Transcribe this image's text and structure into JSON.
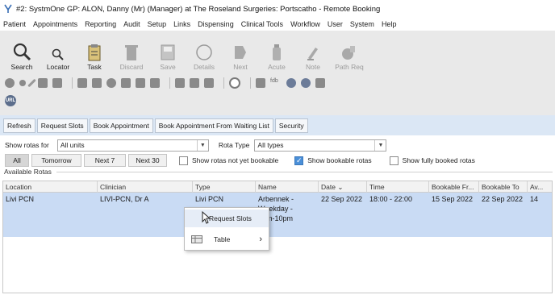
{
  "window": {
    "title": "#2: SystmOne GP: ALON, Danny (Mr) (Manager) at The Roseland Surgeries: Portscatho - Remote Booking"
  },
  "menu": [
    "Patient",
    "Appointments",
    "Reporting",
    "Audit",
    "Setup",
    "Links",
    "Dispensing",
    "Clinical Tools",
    "Workflow",
    "User",
    "System",
    "Help"
  ],
  "toolbar": {
    "items": [
      {
        "label": "Search",
        "icon": "magnifier-large-icon",
        "enabled": true
      },
      {
        "label": "Locator",
        "icon": "magnifier-small-icon",
        "enabled": true
      },
      {
        "label": "Task",
        "icon": "task-clipboard-icon",
        "enabled": true
      },
      {
        "label": "Discard",
        "icon": "trash-bin-icon",
        "enabled": false
      },
      {
        "label": "Save",
        "icon": "save-icon",
        "enabled": false
      },
      {
        "label": "Details",
        "icon": "details-circle-icon",
        "enabled": false
      },
      {
        "label": "Next",
        "icon": "next-arrow-icon",
        "enabled": false
      },
      {
        "label": "Acute",
        "icon": "acute-bottle-icon",
        "enabled": false
      },
      {
        "label": "Note",
        "icon": "note-icon",
        "enabled": false
      },
      {
        "label": "Path Req",
        "icon": "pathology-request-icon",
        "enabled": false
      }
    ],
    "url_icon": "URL"
  },
  "actions": [
    "Refresh",
    "Request Slots",
    "Book Appointment",
    "Book Appointment From Waiting List",
    "Security"
  ],
  "filters": {
    "show_label": "Show rotas for",
    "show_value": "All units",
    "type_label": "Rota Type",
    "type_value": "All types"
  },
  "segments": [
    "All",
    "Tomorrow",
    "Next 7",
    "Next 30"
  ],
  "checks": [
    {
      "label": "Show rotas not yet bookable",
      "checked": false
    },
    {
      "label": "Show bookable rotas",
      "checked": true
    },
    {
      "label": "Show fully booked rotas",
      "checked": false
    }
  ],
  "group_label": "Available Rotas",
  "table": {
    "columns": [
      "Location",
      "Clinician",
      "Type",
      "Name",
      "Date ⌄",
      "Time",
      "Bookable Fr...",
      "Bookable To",
      "Av..."
    ],
    "row": {
      "location": "Livi PCN",
      "clinician": "LIVI-PCN, Dr A",
      "type": "Livi PCN",
      "name_l1": "Arbennek -",
      "name_l2": "Weekday -",
      "name_l3": "6pm-10pm",
      "date": "22 Sep 2022",
      "time": "18:00 - 22:00",
      "bookable_from": "15 Sep 2022",
      "bookable_to": "22 Sep 2022",
      "available": "14"
    }
  },
  "context_menu": {
    "items": [
      {
        "label": "Request Slots"
      },
      {
        "label": "Table",
        "submenu": "›"
      }
    ]
  },
  "colors": {
    "selected_row": "#c9dbf4",
    "action_bar": "#dbe7f5",
    "toolbar_bg": "#e9e9e9",
    "checkbox_on": "#4a8fd8"
  }
}
